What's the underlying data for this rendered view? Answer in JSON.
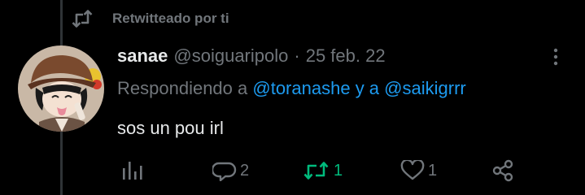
{
  "retweet": {
    "text": "Retwitteado por ti"
  },
  "tweet": {
    "author_name": "sanae",
    "author_handle": "@soiguaripolo",
    "separator": "·",
    "date": "25 feb. 22",
    "replying_prefix": "Respondiendo a",
    "mention_1": "@toranashe",
    "replying_joiner": "y a",
    "mention_2": "@saikigrrr",
    "text": "sos un pou irl"
  },
  "actions": {
    "replies": "2",
    "retweets": "1",
    "likes": "1"
  },
  "colors": {
    "background": "#000000",
    "text_primary": "#e7e9ea",
    "text_secondary": "#71767b",
    "link": "#1d9bf0",
    "retweet_active": "#00ba7c",
    "thread_line": "#2f3336"
  },
  "icons": {
    "retweet_header": "retweet-icon",
    "more": "more-icon",
    "analytics": "analytics-icon",
    "reply": "reply-icon",
    "retweet": "retweet-icon",
    "like": "heart-icon",
    "share": "share-icon"
  }
}
